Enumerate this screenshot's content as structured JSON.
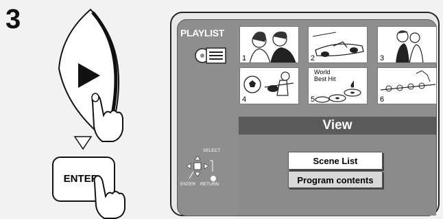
{
  "step_number": "3",
  "remote": {
    "play_glyph": "play-triangle-icon",
    "arrow_glyph": "down-arrow-icon",
    "enter_label": "ENTER"
  },
  "screen": {
    "playlist_label": "PLAYLIST",
    "thumbnails": [
      {
        "number": "1",
        "icon": "couple-talking-icon"
      },
      {
        "number": "2",
        "icon": "race-car-icon"
      },
      {
        "number": "3",
        "icon": "dancing-couple-icon"
      },
      {
        "number": "4",
        "icon": "soccer-guitar-icon"
      },
      {
        "number": "5",
        "icon": "music-cds-icon",
        "caption_line1": "World",
        "caption_line2": "Best Hit"
      },
      {
        "number": "6",
        "icon": "factory-line-icon"
      }
    ],
    "view_title": "View",
    "menu": {
      "selected": "Scene List",
      "other": "Program contents"
    },
    "controls": {
      "select_label": "SELECT",
      "enter_label": "ENTER",
      "return_label": "RETURN"
    }
  },
  "colors": {
    "screen_bg": "#8e8e8e",
    "header_bg": "#5b5b5b"
  }
}
